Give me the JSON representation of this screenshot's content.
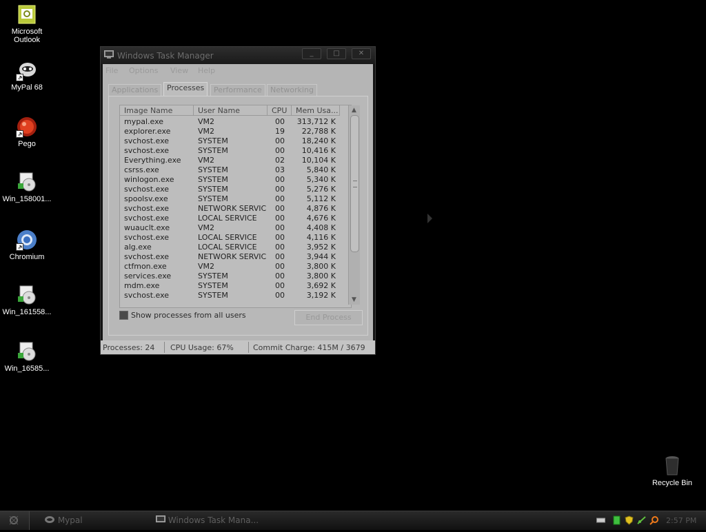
{
  "desktop": {
    "icons": [
      {
        "label": "Microsoft Outlook",
        "icon": "outlook-icon"
      },
      {
        "label": "MyPal 68",
        "icon": "mypal-icon"
      },
      {
        "label": "Pego",
        "icon": "pego-icon"
      },
      {
        "label": "Win_158001...",
        "icon": "installer-icon"
      },
      {
        "label": "Chromium",
        "icon": "chromium-icon"
      },
      {
        "label": "Win_161558...",
        "icon": "installer-icon"
      },
      {
        "label": "Win_16585...",
        "icon": "installer-icon"
      }
    ],
    "recycle_bin": "Recycle Bin"
  },
  "window": {
    "title": "Windows Task Manager",
    "buttons": {
      "minimize": "_",
      "maximize": "□",
      "close": "✕"
    },
    "menu": [
      "File",
      "Options",
      "View",
      "Help"
    ],
    "tabs": [
      "Applications",
      "Processes",
      "Performance",
      "Networking"
    ],
    "active_tab": "Processes",
    "columns": [
      "Image Name",
      "User Name",
      "CPU",
      "Mem Usa..."
    ],
    "processes": [
      {
        "name": "mypal.exe",
        "user": "VM2",
        "cpu": "00",
        "mem": "313,712 K"
      },
      {
        "name": "explorer.exe",
        "user": "VM2",
        "cpu": "19",
        "mem": "22,788 K"
      },
      {
        "name": "svchost.exe",
        "user": "SYSTEM",
        "cpu": "00",
        "mem": "18,240 K"
      },
      {
        "name": "svchost.exe",
        "user": "SYSTEM",
        "cpu": "00",
        "mem": "10,416 K"
      },
      {
        "name": "Everything.exe",
        "user": "VM2",
        "cpu": "02",
        "mem": "10,104 K"
      },
      {
        "name": "csrss.exe",
        "user": "SYSTEM",
        "cpu": "03",
        "mem": "5,840 K"
      },
      {
        "name": "winlogon.exe",
        "user": "SYSTEM",
        "cpu": "00",
        "mem": "5,340 K"
      },
      {
        "name": "svchost.exe",
        "user": "SYSTEM",
        "cpu": "00",
        "mem": "5,276 K"
      },
      {
        "name": "spoolsv.exe",
        "user": "SYSTEM",
        "cpu": "00",
        "mem": "5,112 K"
      },
      {
        "name": "svchost.exe",
        "user": "NETWORK SERVICE",
        "cpu": "00",
        "mem": "4,876 K"
      },
      {
        "name": "svchost.exe",
        "user": "LOCAL SERVICE",
        "cpu": "00",
        "mem": "4,676 K"
      },
      {
        "name": "wuauclt.exe",
        "user": "VM2",
        "cpu": "00",
        "mem": "4,408 K"
      },
      {
        "name": "svchost.exe",
        "user": "LOCAL SERVICE",
        "cpu": "00",
        "mem": "4,116 K"
      },
      {
        "name": "alg.exe",
        "user": "LOCAL SERVICE",
        "cpu": "00",
        "mem": "3,952 K"
      },
      {
        "name": "svchost.exe",
        "user": "NETWORK SERVICE",
        "cpu": "00",
        "mem": "3,944 K"
      },
      {
        "name": "ctfmon.exe",
        "user": "VM2",
        "cpu": "00",
        "mem": "3,800 K"
      },
      {
        "name": "services.exe",
        "user": "SYSTEM",
        "cpu": "00",
        "mem": "3,800 K"
      },
      {
        "name": "mdm.exe",
        "user": "SYSTEM",
        "cpu": "00",
        "mem": "3,692 K"
      },
      {
        "name": "svchost.exe",
        "user": "SYSTEM",
        "cpu": "00",
        "mem": "3,192 K"
      }
    ],
    "show_all_label": "Show processes from all users",
    "end_process_label": "End Process",
    "status": {
      "processes": "Processes: 24",
      "cpu": "CPU Usage: 67%",
      "commit": "Commit Charge: 415M / 3679"
    }
  },
  "taskbar": {
    "tasks": [
      "Mypal",
      "Windows Task Mana..."
    ],
    "clock": "2:57 PM"
  },
  "colors": {
    "desktop": "#000000",
    "client": "#b5b5b5",
    "taskbar": "#1c1c1c"
  }
}
